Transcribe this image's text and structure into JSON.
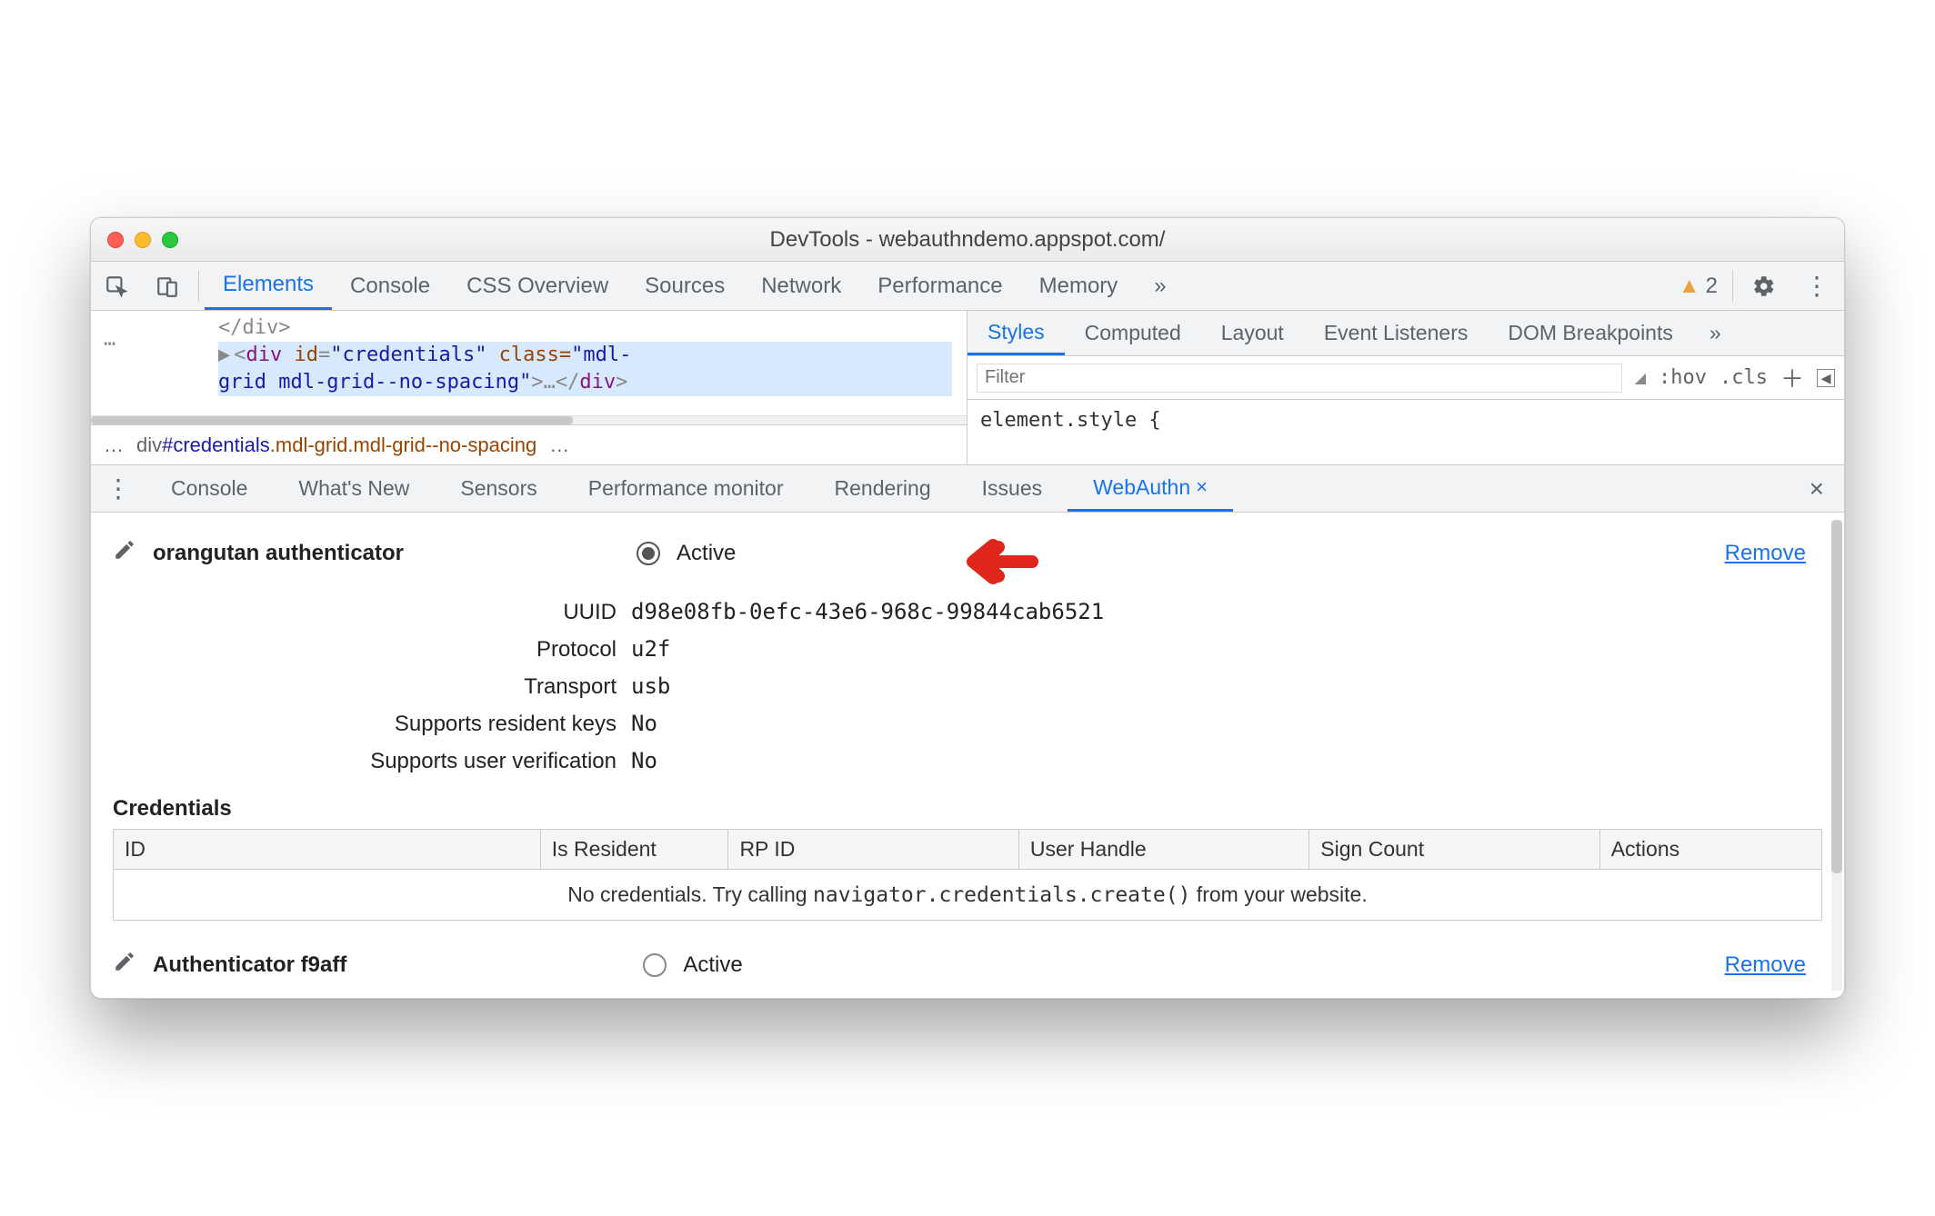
{
  "window": {
    "title": "DevTools - webauthndemo.appspot.com/"
  },
  "main_tabs": {
    "elements": "Elements",
    "console": "Console",
    "css_overview": "CSS Overview",
    "sources": "Sources",
    "network": "Network",
    "performance": "Performance",
    "memory": "Memory",
    "more": "»",
    "warn_count": "2"
  },
  "elements_code": {
    "line0": "</div>",
    "line1_prefix": "<div id=",
    "line1_id": "\"credentials\"",
    "line1_class_attr": " class=",
    "line1_class_val1": "\"mdl-",
    "line2_class_val2": "grid mdl-grid--no-spacing\"",
    "line2_mid": ">…",
    "line2_close": "</div>",
    "breadcrumb_left": "…",
    "breadcrumb_tag": "div",
    "breadcrumb_id": "#credentials",
    "breadcrumb_cls": ".mdl-grid.mdl-grid--no-spacing",
    "breadcrumb_right": "…"
  },
  "styles": {
    "tabs": {
      "styles": "Styles",
      "computed": "Computed",
      "layout": "Layout",
      "event_listeners": "Event Listeners",
      "dom_breakpoints": "DOM Breakpoints",
      "more": "»"
    },
    "filter_placeholder": "Filter",
    "hov": ":hov",
    "cls": ".cls",
    "element_style": "element.style {"
  },
  "drawer": {
    "tabs": {
      "console": "Console",
      "whats_new": "What's New",
      "sensors": "Sensors",
      "perf_monitor": "Performance monitor",
      "rendering": "Rendering",
      "issues": "Issues",
      "webauthn": "WebAuthn"
    }
  },
  "authenticator1": {
    "name": "orangutan authenticator",
    "active": "Active",
    "remove": "Remove",
    "props": {
      "uuid_label": "UUID",
      "uuid_value": "d98e08fb-0efc-43e6-968c-99844cab6521",
      "protocol_label": "Protocol",
      "protocol_value": "u2f",
      "transport_label": "Transport",
      "transport_value": "usb",
      "resident_label": "Supports resident keys",
      "resident_value": "No",
      "userverif_label": "Supports user verification",
      "userverif_value": "No"
    }
  },
  "credentials": {
    "heading": "Credentials",
    "cols": {
      "id": "ID",
      "is_resident": "Is Resident",
      "rp_id": "RP ID",
      "user_handle": "User Handle",
      "sign_count": "Sign Count",
      "actions": "Actions"
    },
    "empty_prefix": "No credentials. Try calling ",
    "empty_code": "navigator.credentials.create()",
    "empty_suffix": " from your website."
  },
  "authenticator2": {
    "name": "Authenticator f9aff",
    "active": "Active",
    "remove": "Remove"
  }
}
